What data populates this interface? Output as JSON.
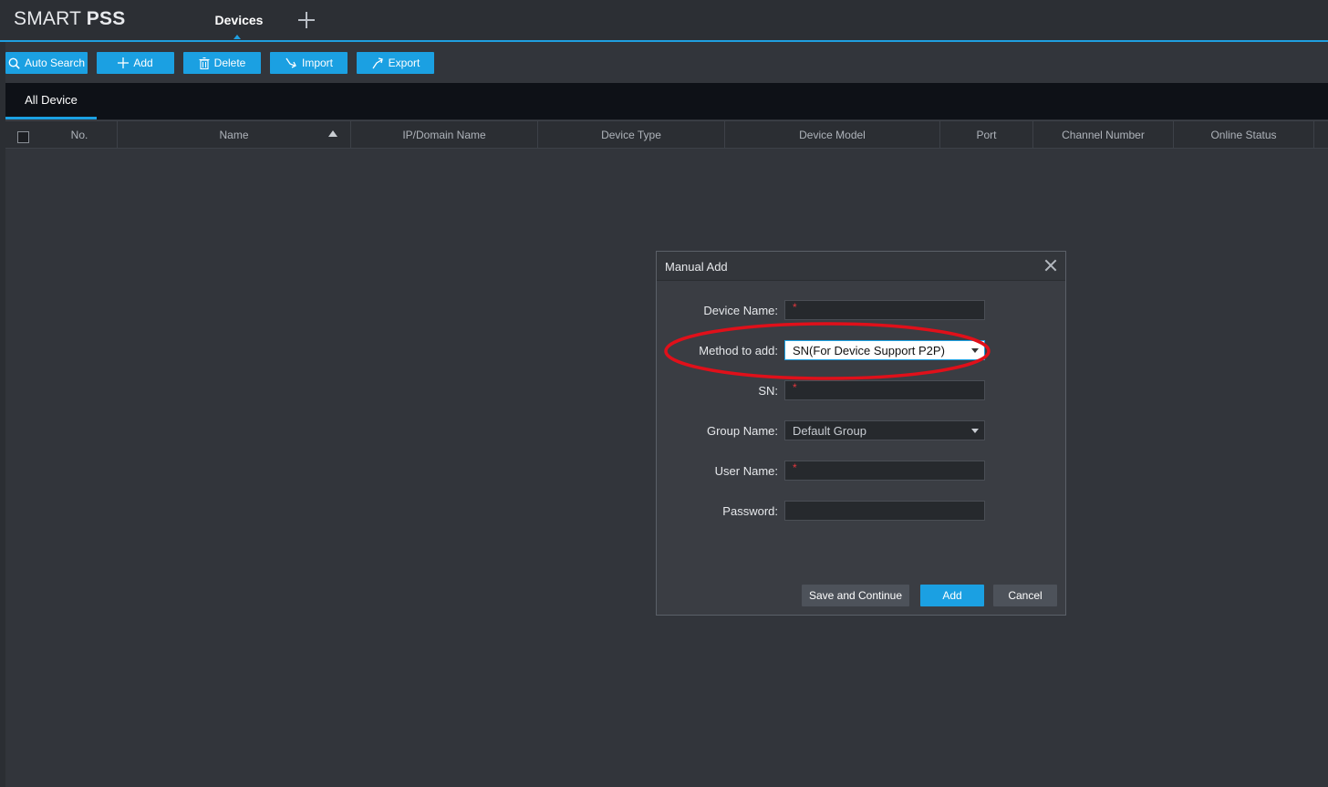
{
  "app": {
    "logo_regular": "SMART",
    "logo_bold": "PSS",
    "active_tab": "Devices"
  },
  "toolbar": {
    "auto_search": "Auto Search",
    "add": "Add",
    "delete": "Delete",
    "import": "Import",
    "export": "Export"
  },
  "subtabs": {
    "all_device": "All Device"
  },
  "table": {
    "columns": [
      "No.",
      "Name",
      "IP/Domain Name",
      "Device Type",
      "Device Model",
      "Port",
      "Channel Number",
      "Online Status"
    ],
    "sorted_column": "Name",
    "sort_direction": "ascending"
  },
  "dialog": {
    "title": "Manual Add",
    "device_name_label": "Device Name:",
    "method_label": "Method to add:",
    "method_value": "SN(For Device Support P2P)",
    "sn_label": "SN:",
    "group_label": "Group Name:",
    "group_value": "Default Group",
    "user_label": "User Name:",
    "password_label": "Password:",
    "required_mark": "*",
    "save_continue": "Save and Continue",
    "add": "Add",
    "cancel": "Cancel"
  },
  "colors": {
    "accent": "#1ba0e2",
    "annotation": "#e0101a",
    "background": "#32353b"
  }
}
